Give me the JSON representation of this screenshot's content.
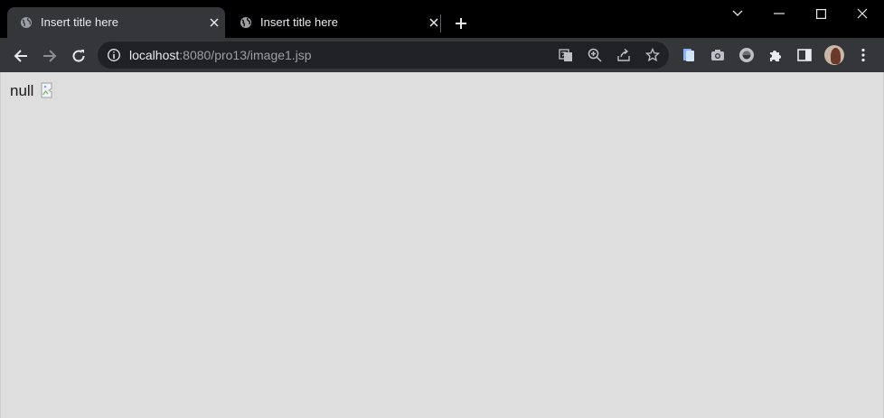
{
  "tabs": [
    {
      "title": "Insert title here",
      "active": true
    },
    {
      "title": "Insert title here",
      "active": false
    }
  ],
  "address_bar": {
    "host": "localhost",
    "path": ":8080/pro13/image1.jsp"
  },
  "page": {
    "text": "null"
  },
  "icons": {
    "favicon": "globe-icon",
    "new_tab": "plus-icon",
    "window": [
      "tab-search-icon",
      "minimize-icon",
      "maximize-icon",
      "close-icon"
    ],
    "nav": [
      "back-arrow-icon",
      "forward-arrow-icon",
      "reload-icon"
    ],
    "omnibox": [
      "site-info-icon",
      "translate-icon",
      "zoom-icon",
      "share-icon",
      "bookmark-star-icon"
    ],
    "extensions": [
      "clipboard-extension-icon",
      "camera-extension-icon",
      "circle-extension-icon",
      "puzzle-icon",
      "side-panel-icon"
    ]
  },
  "colors": {
    "tabstrip": "#000000",
    "active_tab": "#35363a",
    "toolbar": "#35363a",
    "omnibox": "#202124",
    "page_background": "#dedede"
  }
}
